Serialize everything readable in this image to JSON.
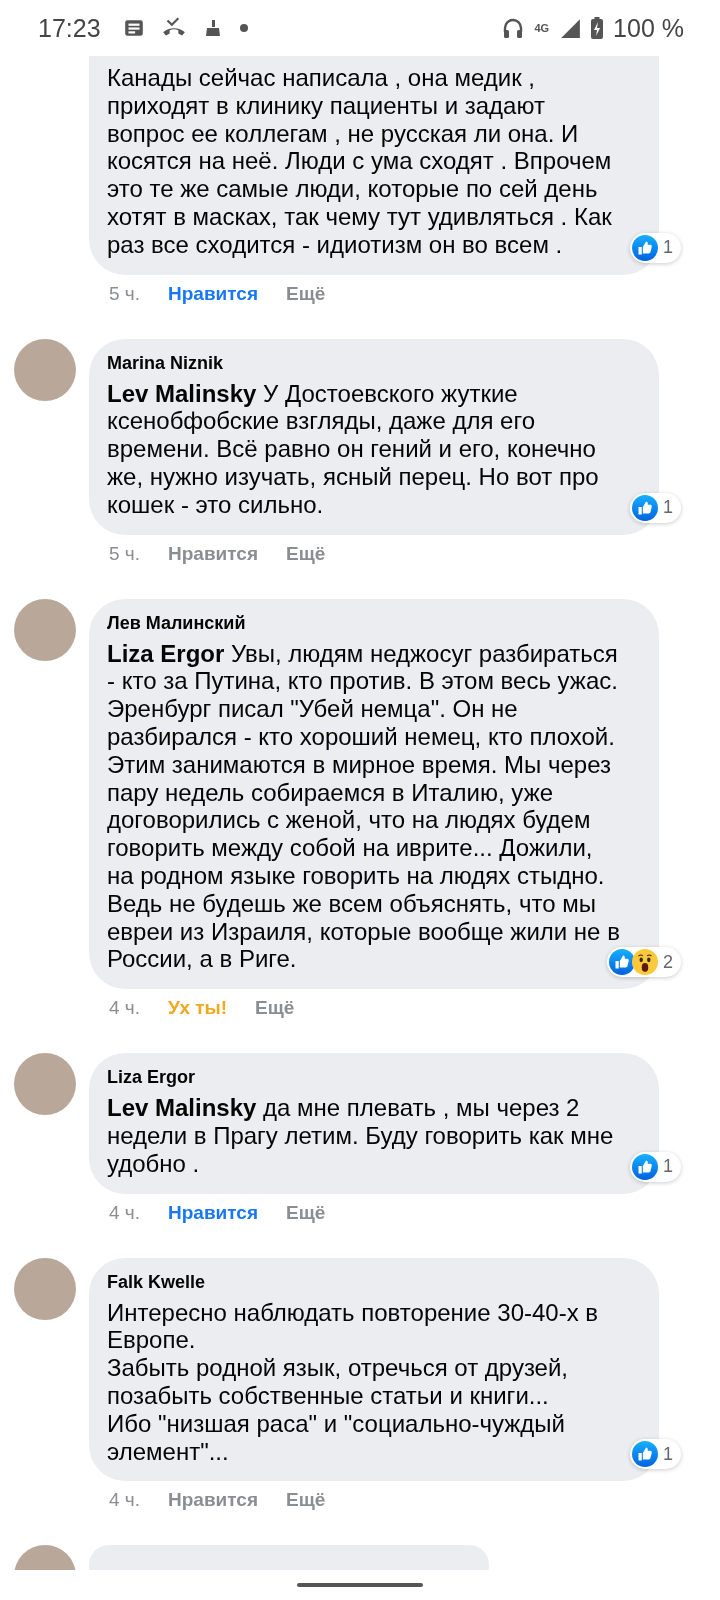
{
  "status_bar": {
    "time": "17:23",
    "network": "4G",
    "battery": "100 %"
  },
  "comments": [
    {
      "text": "Канады сейчас написала , она медик , приходят в клинику пациенты и задают вопрос ее коллегам , не русская ли она. И косятся на неё. Люди с ума сходят . Впрочем это те же самые люди, которые по сей день хотят в масках, так чему тут удивляться . Как раз все сходится - идиотизм он во всем .",
      "cut": true,
      "reactions": [
        {
          "kind": "like"
        }
      ],
      "reaction_count": "1",
      "time": "5 ч.",
      "action": {
        "label": "Нравится",
        "selected": true
      },
      "more": "Ещё"
    },
    {
      "author": "Marina Niznik",
      "text": "**Lev Malinsky** У Достоевского жуткие ксенобфобские взгляды, даже для его времени. Всё равно он гений и его, конечно же, нужно изучать, ясный перец. Но вот про кошек - это сильно.",
      "cut": false,
      "reactions": [
        {
          "kind": "like"
        }
      ],
      "reaction_count": "1",
      "time": "5 ч.",
      "action": {
        "label": "Нравится",
        "selected": false
      },
      "more": "Ещё"
    },
    {
      "author": "Лев Малинский",
      "text": "**Liza Ergor** Увы, людям неджосуг разбираться - кто за Путина, кто против. В этом весь ужас. Эренбург писал \"Убей немца\". Он не разбирался - кто хороший немец, кто плохой. Этим занимаются в мирное время. Мы через пару недель собираемся в Италию, уже договорились с женой, что на людях будем говорить между собой на иврите... Дожили, на родном языке говорить на людях стыдно. Ведь не будешь же всем объяснять, что мы евреи из Израиля, которые вообще жили не в России, а в Риге.",
      "cut": false,
      "reactions": [
        {
          "kind": "like"
        },
        {
          "kind": "wow"
        }
      ],
      "reaction_count": "2",
      "time": "4 ч.",
      "action": {
        "label": "Ух ты!",
        "selected": true,
        "wow": true
      },
      "more": "Ещё"
    },
    {
      "author": "Liza Ergor",
      "text": "**Lev Malinsky** да мне плевать , мы через 2 недели в Прагу летим. Буду говорить как мне удобно .",
      "cut": false,
      "reactions": [
        {
          "kind": "like"
        }
      ],
      "reaction_count": "1",
      "time": "4 ч.",
      "action": {
        "label": "Нравится",
        "selected": true
      },
      "more": "Ещё"
    },
    {
      "author": "Falk Kwelle",
      "text": "Интересно наблюдать повторение 30-40-х в Европе.\nЗабыть родной язык, отречься от друзей, позабыть собственные статьи и книги...\nИбо \"низшая раса\" и \"социально-чуждый элемент\"...",
      "cut": false,
      "reactions": [
        {
          "kind": "like"
        }
      ],
      "reaction_count": "1",
      "time": "4 ч.",
      "action": {
        "label": "Нравится",
        "selected": false
      },
      "more": "Ещё"
    }
  ]
}
